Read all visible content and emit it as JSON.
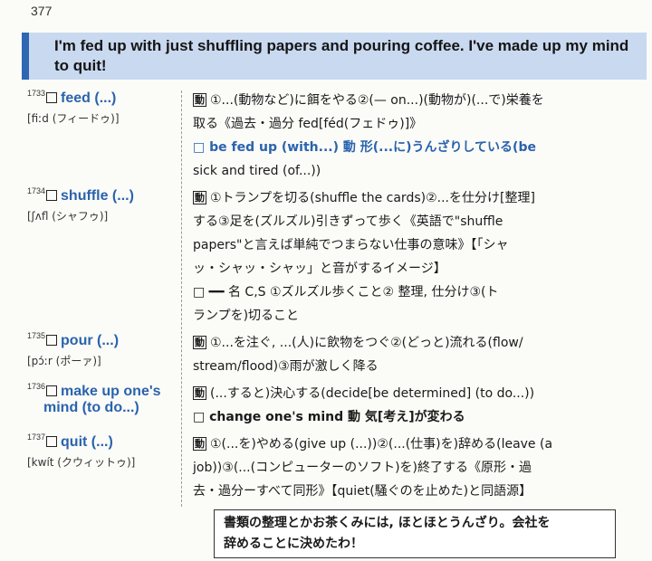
{
  "page_number": "377",
  "heading": "I'm fed up with just shuffling papers and pouring coffee. I've made up my mind to quit!",
  "entries": [
    {
      "num": "1733",
      "word": "feed (...)",
      "pron": "[fiːd (フィードゥ)]",
      "pos": "動",
      "def1": "①...(動物など)に餌をやる②(— on...)(動物が)(...で)栄養を",
      "def2": "取る《過去・過分 fed[féd(フェドゥ)]》",
      "def3": "□ be fed up (with...) 動 形(...に)うんざりしている(be",
      "def4": "sick and tired (of...))"
    },
    {
      "num": "1734",
      "word": "shuffle (...)",
      "pron": "[ʃʌfl (シャフゥ)]",
      "pos": "動",
      "def1": "①トランプを切る(shuffle the cards)②...を仕分け[整理]",
      "def2": "する③足を(ズルズル)引きずって歩く《英語で\"shuffle",
      "def3": "papers\"と言えば単純でつまらない仕事の意味》【「シャ",
      "def4": "ッ・シャッ・シャッ」と音がするイメージ】",
      "def5": "□ ━━ 名 C,S ①ズルズル歩くこと② 整理, 仕分け③(ト",
      "def6": "ランプを)切ること"
    },
    {
      "num": "1735",
      "word": "pour (...)",
      "pron": "[pɔ́ːr (ポーァ)]",
      "pos": "動",
      "def1": "①...を注ぐ, ...(人)に飲物をつぐ②(どっと)流れる(flow/",
      "def2": "stream/flood)③雨が激しく降る"
    },
    {
      "num": "1736",
      "word": "make up one's",
      "word2": "mind (to do...)",
      "pos": "動",
      "def1": "(...すると)決心する(decide[be determined] (to do...))",
      "def2": "□ change one's mind 動 気[考え]が変わる"
    },
    {
      "num": "1737",
      "word": "quit (...)",
      "pron": "[kwít (クウィットゥ)]",
      "pos": "動",
      "def1": "①(...を)やめる(give up (...))②(...(仕事)を)辞める(leave (a",
      "def2": "job))③(...(コンピューターのソフト)を)終了する《原形・過",
      "def3": "去・過分ーすべて同形》【quiet(騒ぐのを止めた)と同語源】"
    }
  ],
  "note": {
    "line1": "書類の整理とかお茶くみには, ほとほとうんざり。会社を",
    "line2": "辞めることに決めたわ！"
  }
}
